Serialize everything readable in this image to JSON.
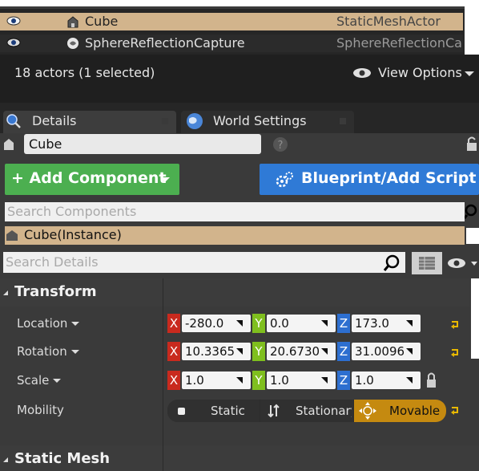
{
  "outliner": {
    "rows": [
      {
        "name": "Cube",
        "type": "StaticMeshActor",
        "icon": "static-mesh-actor-icon"
      },
      {
        "name": "SphereReflectionCapture",
        "type": "SphereReflectionCa",
        "icon": "sphere-reflection-capture-icon"
      }
    ],
    "actor_count": "18 actors (1 selected)",
    "view_options": "View Options"
  },
  "tabs": {
    "details": "Details",
    "world_settings": "World Settings"
  },
  "actor_name": "Cube",
  "buttons": {
    "add_component": "+ Add Component",
    "blueprint": "Blueprint/Add Script"
  },
  "search_components_placeholder": "Search Components",
  "component_instance": "Cube(Instance)",
  "search_details_placeholder": "Search Details",
  "sections": {
    "transform": "Transform",
    "static_mesh": "Static Mesh"
  },
  "transform": {
    "location": {
      "label": "Location",
      "x": "-280.0",
      "y": "0.0",
      "z": "173.0"
    },
    "rotation": {
      "label": "Rotation",
      "x": "10.3365",
      "y": "20.6730",
      "z": "31.0096"
    },
    "scale": {
      "label": "Scale",
      "x": "1.0",
      "y": "1.0",
      "z": "1.0"
    },
    "mobility": {
      "label": "Mobility",
      "options": [
        "Static",
        "Stationary",
        "Movable"
      ],
      "selected": "Movable"
    }
  },
  "axis_letters": {
    "x": "X",
    "y": "Y",
    "z": "Z"
  },
  "colors": {
    "selection": "#d2b48c",
    "add_component": "#4caf50",
    "blueprint": "#2f7ad6",
    "mobility_selected": "#c58a10",
    "reset_arrow": "#e8b800"
  }
}
